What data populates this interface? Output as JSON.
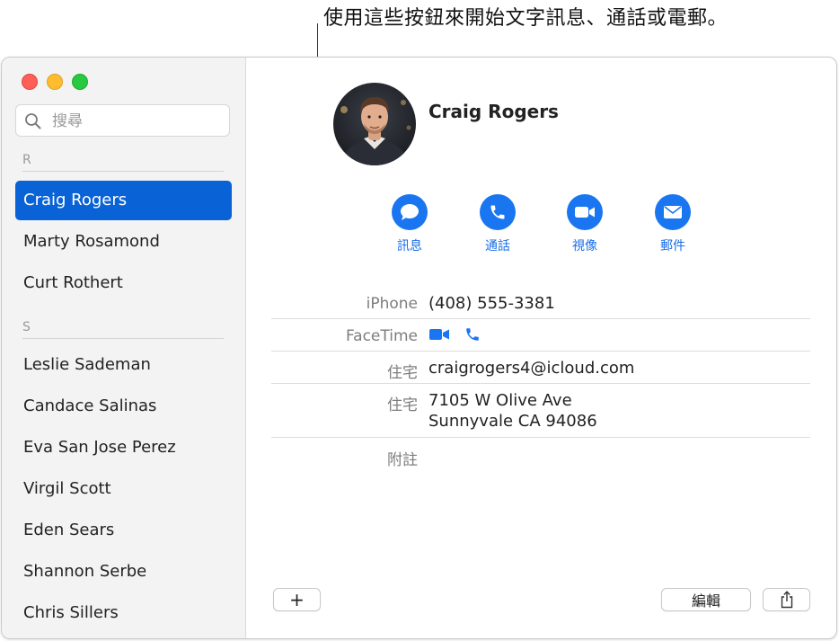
{
  "callout": {
    "text": "使用這些按鈕來開始文字訊息、通話或電郵。"
  },
  "search": {
    "placeholder": "搜尋",
    "icon": "search-icon"
  },
  "sections": [
    {
      "letter": "R"
    },
    {
      "letter": "S"
    }
  ],
  "contacts": [
    {
      "name": "Craig Rogers",
      "selected": true
    },
    {
      "name": "Marty Rosamond"
    },
    {
      "name": "Curt Rothert"
    },
    {
      "name": "Leslie Sademan"
    },
    {
      "name": "Candace Salinas"
    },
    {
      "name": "Eva San Jose Perez"
    },
    {
      "name": "Virgil Scott"
    },
    {
      "name": "Eden Sears"
    },
    {
      "name": "Shannon Serbe"
    },
    {
      "name": "Chris Sillers"
    }
  ],
  "detail": {
    "name": "Craig Rogers",
    "actions": [
      {
        "label": "訊息",
        "icon": "message-bubble-icon"
      },
      {
        "label": "通話",
        "icon": "phone-icon"
      },
      {
        "label": "視像",
        "icon": "video-camera-icon"
      },
      {
        "label": "郵件",
        "icon": "envelope-icon"
      }
    ],
    "fields": {
      "iphone_label": "iPhone",
      "iphone_value": "(408) 555-3381",
      "facetime_label": "FaceTime",
      "email_label": "住宅",
      "email_value": "craigrogers4@icloud.com",
      "address_label": "住宅",
      "address_line1": "7105 W Olive Ave",
      "address_line2": "Sunnyvale CA 94086",
      "notes_label": "附註"
    }
  },
  "footer": {
    "add_label": "+",
    "edit_label": "編輯",
    "share_icon": "share-icon"
  },
  "colors": {
    "accent": "#0a63d6",
    "action_blue": "#1a76f0",
    "sidebar_bg": "#f3f3f3"
  }
}
